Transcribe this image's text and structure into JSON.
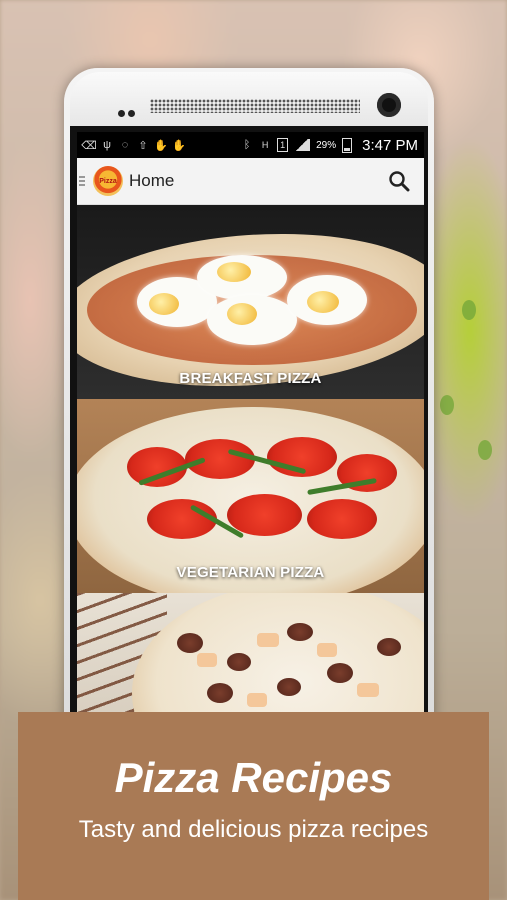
{
  "status_bar": {
    "battery_percent": "29%",
    "time": "3:47 PM",
    "icons": [
      "back-icon",
      "usb-icon",
      "whatsapp-icon",
      "upload-icon",
      "hand-icon",
      "hand-icon",
      "bluetooth-icon",
      "h-signal-icon",
      "sim-1-icon",
      "signal-icon",
      "battery-icon"
    ]
  },
  "app_bar": {
    "logo_text": "Pizza",
    "title": "Home",
    "search_icon": "search-icon"
  },
  "recipes": [
    {
      "label": "BREAKFAST PIZZA"
    },
    {
      "label": "VEGETARIAN PIZZA"
    },
    {
      "label": ""
    }
  ],
  "banner": {
    "title": "Pizza Recipes",
    "subtitle": "Tasty and delicious pizza recipes"
  },
  "colors": {
    "banner": "#a97a55",
    "app_bar": "#f3f3f3",
    "status_bar": "#000000"
  }
}
